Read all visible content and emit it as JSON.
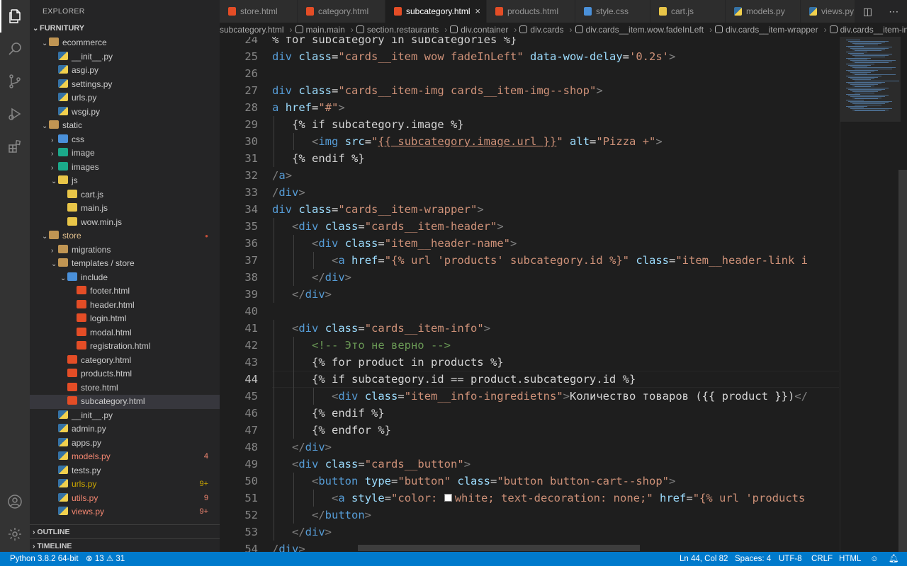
{
  "explorer": {
    "title": "EXPLORER",
    "root": "FURNITURY",
    "items": [
      {
        "label": "ecommerce",
        "kind": "folder",
        "depth": 1,
        "chev": "open"
      },
      {
        "label": "__init__.py",
        "kind": "py",
        "depth": 2
      },
      {
        "label": "asgi.py",
        "kind": "py",
        "depth": 2
      },
      {
        "label": "settings.py",
        "kind": "py",
        "depth": 2
      },
      {
        "label": "urls.py",
        "kind": "py",
        "depth": 2
      },
      {
        "label": "wsgi.py",
        "kind": "py",
        "depth": 2
      },
      {
        "label": "static",
        "kind": "folder",
        "depth": 1,
        "chev": "open"
      },
      {
        "label": "css",
        "kind": "folder-css",
        "depth": 2,
        "chev": "closed"
      },
      {
        "label": "image",
        "kind": "folder-img",
        "depth": 2,
        "chev": "closed"
      },
      {
        "label": "images",
        "kind": "folder-img",
        "depth": 2,
        "chev": "closed"
      },
      {
        "label": "js",
        "kind": "folder-js",
        "depth": 2,
        "chev": "open"
      },
      {
        "label": "cart.js",
        "kind": "js",
        "depth": 3
      },
      {
        "label": "main.js",
        "kind": "js",
        "depth": 3
      },
      {
        "label": "wow.min.js",
        "kind": "js",
        "depth": 3
      },
      {
        "label": "store",
        "kind": "folder",
        "depth": 1,
        "chev": "open",
        "color": "#e2c08d",
        "dot": true
      },
      {
        "label": "migrations",
        "kind": "folder",
        "depth": 2,
        "chev": "closed"
      },
      {
        "label": "templates / store",
        "kind": "folder",
        "depth": 2,
        "chev": "open"
      },
      {
        "label": "include",
        "kind": "folder-inc",
        "depth": 3,
        "chev": "open"
      },
      {
        "label": "footer.html",
        "kind": "html",
        "depth": 4
      },
      {
        "label": "header.html",
        "kind": "html",
        "depth": 4
      },
      {
        "label": "login.html",
        "kind": "html",
        "depth": 4
      },
      {
        "label": "modal.html",
        "kind": "html",
        "depth": 4
      },
      {
        "label": "registration.html",
        "kind": "html",
        "depth": 4
      },
      {
        "label": "category.html",
        "kind": "html",
        "depth": 3
      },
      {
        "label": "products.html",
        "kind": "html",
        "depth": 3
      },
      {
        "label": "store.html",
        "kind": "html",
        "depth": 3
      },
      {
        "label": "subcategory.html",
        "kind": "html",
        "depth": 3,
        "selected": true
      },
      {
        "label": "__init__.py",
        "kind": "py",
        "depth": 2
      },
      {
        "label": "admin.py",
        "kind": "py",
        "depth": 2
      },
      {
        "label": "apps.py",
        "kind": "py",
        "depth": 2
      },
      {
        "label": "models.py",
        "kind": "py",
        "depth": 2,
        "color": "#f48771",
        "badge": "4",
        "badgeColor": "#f48771"
      },
      {
        "label": "tests.py",
        "kind": "py",
        "depth": 2
      },
      {
        "label": "urls.py",
        "kind": "py",
        "depth": 2,
        "color": "#cca700",
        "badge": "9+",
        "badgeColor": "#cca700"
      },
      {
        "label": "utils.py",
        "kind": "py",
        "depth": 2,
        "color": "#f48771",
        "badge": "9",
        "badgeColor": "#f48771"
      },
      {
        "label": "views.py",
        "kind": "py",
        "depth": 2,
        "color": "#f48771",
        "badge": "9+",
        "badgeColor": "#f48771"
      }
    ],
    "outline": "OUTLINE",
    "timeline": "TIMELINE"
  },
  "tabs": [
    {
      "label": "store.html",
      "kind": "html",
      "width": 110
    },
    {
      "label": "category.html",
      "kind": "html",
      "width": 124
    },
    {
      "label": "subcategory.html",
      "kind": "html",
      "width": 143,
      "active": true,
      "close": "×"
    },
    {
      "label": "products.html",
      "kind": "html",
      "width": 125
    },
    {
      "label": "style.css",
      "kind": "css",
      "width": 106
    },
    {
      "label": "cart.js",
      "kind": "js",
      "width": 106
    },
    {
      "label": "models.py",
      "kind": "py",
      "width": 106
    },
    {
      "label": "views.py",
      "kind": "py",
      "width": 100
    }
  ],
  "breadcrumb": [
    "subcategory.html",
    "main.main",
    "section.restaurants",
    "div.container",
    "div.cards",
    "div.cards__item.wow.fadeInLeft",
    "div.cards__item-wrapper",
    "div.cards__item-info"
  ],
  "editor": {
    "current_line": 44,
    "lines": [
      {
        "n": 24,
        "i": 0,
        "t": [
          [
            "t-tpl",
            "% for subcategory in subcategories %}"
          ]
        ]
      },
      {
        "n": 25,
        "i": 0,
        "t": [
          [
            "t-tag",
            "div"
          ],
          [
            "t-tpl",
            " "
          ],
          [
            "t-attr",
            "class"
          ],
          [
            "t-tpl",
            "="
          ],
          [
            "t-str",
            "\"cards__item wow fadeInLeft\""
          ],
          [
            "t-tpl",
            " "
          ],
          [
            "t-attr",
            "data-wow-delay"
          ],
          [
            "t-tpl",
            "="
          ],
          [
            "t-str",
            "'0.2s'"
          ],
          [
            "t-punc",
            ">"
          ]
        ]
      },
      {
        "n": 26,
        "i": 0,
        "t": []
      },
      {
        "n": 27,
        "i": 0,
        "t": [
          [
            "t-tag",
            "div"
          ],
          [
            "t-tpl",
            " "
          ],
          [
            "t-attr",
            "class"
          ],
          [
            "t-tpl",
            "="
          ],
          [
            "t-str",
            "\"cards__item-img cards__item-img--shop\""
          ],
          [
            "t-punc",
            ">"
          ]
        ]
      },
      {
        "n": 28,
        "i": 0,
        "t": [
          [
            "t-tag",
            "a"
          ],
          [
            "t-tpl",
            " "
          ],
          [
            "t-attr",
            "href"
          ],
          [
            "t-tpl",
            "="
          ],
          [
            "t-str",
            "\"#\""
          ],
          [
            "t-punc",
            ">"
          ]
        ]
      },
      {
        "n": 29,
        "i": 1,
        "t": [
          [
            "t-tpl",
            "{% if subcategory.image %}"
          ]
        ]
      },
      {
        "n": 30,
        "i": 2,
        "t": [
          [
            "t-punc",
            "<"
          ],
          [
            "t-tag",
            "img"
          ],
          [
            "t-tpl",
            " "
          ],
          [
            "t-attr",
            "src"
          ],
          [
            "t-tpl",
            "="
          ],
          [
            "t-str",
            "\""
          ],
          [
            "t-str t-under",
            "{{ subcategory.image.url }}"
          ],
          [
            "t-str",
            "\""
          ],
          [
            "t-tpl",
            " "
          ],
          [
            "t-attr",
            "alt"
          ],
          [
            "t-tpl",
            "="
          ],
          [
            "t-str",
            "\"Pizza +\""
          ],
          [
            "t-punc",
            ">"
          ]
        ]
      },
      {
        "n": 31,
        "i": 1,
        "t": [
          [
            "t-tpl",
            "{% endif %}"
          ]
        ]
      },
      {
        "n": 32,
        "i": 0,
        "t": [
          [
            "t-punc",
            "/"
          ],
          [
            "t-tag",
            "a"
          ],
          [
            "t-punc",
            ">"
          ]
        ]
      },
      {
        "n": 33,
        "i": 0,
        "t": [
          [
            "t-punc",
            "/"
          ],
          [
            "t-tag",
            "div"
          ],
          [
            "t-punc",
            ">"
          ]
        ]
      },
      {
        "n": 34,
        "i": 0,
        "t": [
          [
            "t-tag",
            "div"
          ],
          [
            "t-tpl",
            " "
          ],
          [
            "t-attr",
            "class"
          ],
          [
            "t-tpl",
            "="
          ],
          [
            "t-str",
            "\"cards__item-wrapper\""
          ],
          [
            "t-punc",
            ">"
          ]
        ]
      },
      {
        "n": 35,
        "i": 1,
        "t": [
          [
            "t-punc",
            "<"
          ],
          [
            "t-tag",
            "div"
          ],
          [
            "t-tpl",
            " "
          ],
          [
            "t-attr",
            "class"
          ],
          [
            "t-tpl",
            "="
          ],
          [
            "t-str",
            "\"cards__item-header\""
          ],
          [
            "t-punc",
            ">"
          ]
        ]
      },
      {
        "n": 36,
        "i": 2,
        "t": [
          [
            "t-punc",
            "<"
          ],
          [
            "t-tag",
            "div"
          ],
          [
            "t-tpl",
            " "
          ],
          [
            "t-attr",
            "class"
          ],
          [
            "t-tpl",
            "="
          ],
          [
            "t-str",
            "\"item__header-name\""
          ],
          [
            "t-punc",
            ">"
          ]
        ]
      },
      {
        "n": 37,
        "i": 3,
        "t": [
          [
            "t-punc",
            "<"
          ],
          [
            "t-tag",
            "a"
          ],
          [
            "t-tpl",
            " "
          ],
          [
            "t-attr",
            "href"
          ],
          [
            "t-tpl",
            "="
          ],
          [
            "t-str",
            "\"{% url 'products' subcategory.id %}\""
          ],
          [
            "t-tpl",
            " "
          ],
          [
            "t-attr",
            "class"
          ],
          [
            "t-tpl",
            "="
          ],
          [
            "t-str",
            "\"item__header-link i"
          ]
        ]
      },
      {
        "n": 38,
        "i": 2,
        "t": [
          [
            "t-punc",
            "</"
          ],
          [
            "t-tag",
            "div"
          ],
          [
            "t-punc",
            ">"
          ]
        ]
      },
      {
        "n": 39,
        "i": 1,
        "t": [
          [
            "t-punc",
            "</"
          ],
          [
            "t-tag",
            "div"
          ],
          [
            "t-punc",
            ">"
          ]
        ]
      },
      {
        "n": 40,
        "i": 0,
        "t": []
      },
      {
        "n": 41,
        "i": 1,
        "t": [
          [
            "t-punc",
            "<"
          ],
          [
            "t-tag",
            "div"
          ],
          [
            "t-tpl",
            " "
          ],
          [
            "t-attr",
            "class"
          ],
          [
            "t-tpl",
            "="
          ],
          [
            "t-str",
            "\"cards__item-info\""
          ],
          [
            "t-punc",
            ">"
          ]
        ]
      },
      {
        "n": 42,
        "i": 2,
        "t": [
          [
            "t-cmt",
            "<!-- Это не верно -->"
          ]
        ]
      },
      {
        "n": 43,
        "i": 2,
        "t": [
          [
            "t-tpl",
            "{% for product in products %}"
          ]
        ]
      },
      {
        "n": 44,
        "i": 2,
        "t": [
          [
            "t-tpl",
            "{% if subcategory.id == product.subcategory.id %}"
          ]
        ]
      },
      {
        "n": 45,
        "i": 3,
        "t": [
          [
            "t-punc",
            "<"
          ],
          [
            "t-tag",
            "div"
          ],
          [
            "t-tpl",
            " "
          ],
          [
            "t-attr",
            "class"
          ],
          [
            "t-tpl",
            "="
          ],
          [
            "t-str",
            "\"item__info-ingredietns\""
          ],
          [
            "t-punc",
            ">"
          ],
          [
            "t-tpl",
            "Количество товаров ({{ product }})"
          ],
          [
            "t-punc",
            "</"
          ]
        ]
      },
      {
        "n": 46,
        "i": 2,
        "t": [
          [
            "t-tpl",
            "{% endif %}"
          ]
        ]
      },
      {
        "n": 47,
        "i": 2,
        "t": [
          [
            "t-tpl",
            "{% endfor %}"
          ]
        ]
      },
      {
        "n": 48,
        "i": 1,
        "t": [
          [
            "t-punc",
            "</"
          ],
          [
            "t-tag",
            "div"
          ],
          [
            "t-punc",
            ">"
          ]
        ]
      },
      {
        "n": 49,
        "i": 1,
        "t": [
          [
            "t-punc",
            "<"
          ],
          [
            "t-tag",
            "div"
          ],
          [
            "t-tpl",
            " "
          ],
          [
            "t-attr",
            "class"
          ],
          [
            "t-tpl",
            "="
          ],
          [
            "t-str",
            "\"cards__button\""
          ],
          [
            "t-punc",
            ">"
          ]
        ]
      },
      {
        "n": 50,
        "i": 2,
        "t": [
          [
            "t-punc",
            "<"
          ],
          [
            "t-tag",
            "button"
          ],
          [
            "t-tpl",
            " "
          ],
          [
            "t-attr",
            "type"
          ],
          [
            "t-tpl",
            "="
          ],
          [
            "t-str",
            "\"button\""
          ],
          [
            "t-tpl",
            " "
          ],
          [
            "t-attr",
            "class"
          ],
          [
            "t-tpl",
            "="
          ],
          [
            "t-str",
            "\"button button-cart--shop\""
          ],
          [
            "t-punc",
            ">"
          ]
        ]
      },
      {
        "n": 51,
        "i": 3,
        "t": [
          [
            "t-punc",
            "<"
          ],
          [
            "t-tag",
            "a"
          ],
          [
            "t-tpl",
            " "
          ],
          [
            "t-attr",
            "style"
          ],
          [
            "t-tpl",
            "="
          ],
          [
            "t-str",
            "\"color: "
          ],
          [
            "swatch",
            ""
          ],
          [
            "t-str",
            "white; text-decoration: none;\""
          ],
          [
            "t-tpl",
            " "
          ],
          [
            "t-attr",
            "href"
          ],
          [
            "t-tpl",
            "="
          ],
          [
            "t-str",
            "\"{% url 'products"
          ]
        ]
      },
      {
        "n": 52,
        "i": 2,
        "t": [
          [
            "t-punc",
            "</"
          ],
          [
            "t-tag",
            "button"
          ],
          [
            "t-punc",
            ">"
          ]
        ]
      },
      {
        "n": 53,
        "i": 1,
        "t": [
          [
            "t-punc",
            "</"
          ],
          [
            "t-tag",
            "div"
          ],
          [
            "t-punc",
            ">"
          ]
        ]
      },
      {
        "n": 54,
        "i": 0,
        "t": [
          [
            "t-punc",
            "/"
          ],
          [
            "t-tag",
            "div"
          ],
          [
            "t-punc",
            ">"
          ]
        ]
      }
    ]
  },
  "status": {
    "python": "Python 3.8.2 64-bit",
    "errors": "13",
    "warnings": "31",
    "position": "Ln 44, Col 82",
    "spaces": "Spaces: 4",
    "encoding": "UTF-8",
    "eol": "CRLF",
    "language": "HTML"
  },
  "colors": {
    "accent": "#007acc",
    "activity_bg": "#333333",
    "sidebar_bg": "#252526",
    "editor_bg": "#1e1e1e"
  }
}
